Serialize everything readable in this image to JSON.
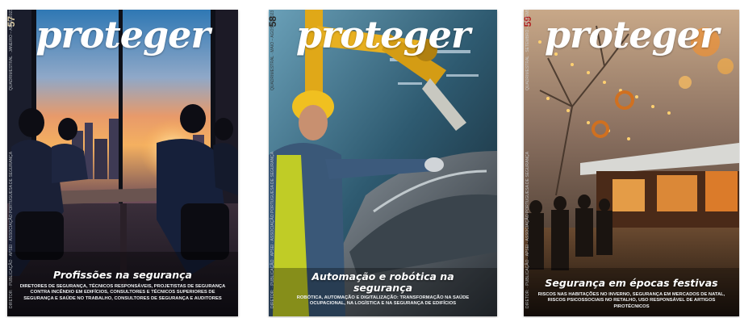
{
  "covers": [
    {
      "masthead": "proteger",
      "issue": "57",
      "side_top": "QUADRIMESTRAL · JANEIRO – ABRIL 2023",
      "side_bottom": "DIRETOR: · PUBLICAÇÃO · APSEI · ASSOCIAÇÃO PORTUGUESA DE SEGURANÇA",
      "headline": "Profissões na segurança",
      "subtitle": "DIRETORES DE SEGURANÇA, TÉCNICOS RESPONSÁVEIS, PROJETISTAS DE SEGURANÇA CONTRA INCÊNDIO EM EDIFÍCIOS, CONSULTORES E TÉCNICOS SUPERIORES DE SEGURANÇA E SAÚDE NO TRABALHO, CONSULTORES DE SEGURANÇA E AUDITORES"
    },
    {
      "masthead": "proteger",
      "issue": "58",
      "side_top": "QUADRIMESTRAL · MAIO – AGOSTO 2023",
      "side_bottom": "DIRETOR: · PUBLICAÇÃO · APSEI · ASSOCIAÇÃO PORTUGUESA DE SEGURANÇA",
      "headline": "Automação e robótica na segurança",
      "subtitle": "ROBÓTICA, AUTOMAÇÃO E DIGITALIZAÇÃO: TRANSFORMAÇÃO NA SAÚDE OCUPACIONAL, NA LOGÍSTICA E NA SEGURANÇA DE EDIFÍCIOS"
    },
    {
      "masthead": "proteger",
      "issue": "59",
      "side_top": "QUADRIMESTRAL · SETEMBRO – DEZEMBRO 2023",
      "side_bottom": "DIRETOR: · PUBLICAÇÃO · APSEI · ASSOCIAÇÃO PORTUGUESA DE SEGURANÇA",
      "headline": "Segurança em épocas festivas",
      "subtitle": "RISCOS NAS HABITAÇÕES NO INVERNO, SEGURANÇA EM MERCADOS DE NATAL, RISCOS PSICOSSOCIAIS NO RETALHO, USO RESPONSÁVEL DE ARTIGOS PIROTÉCNICOS"
    }
  ]
}
